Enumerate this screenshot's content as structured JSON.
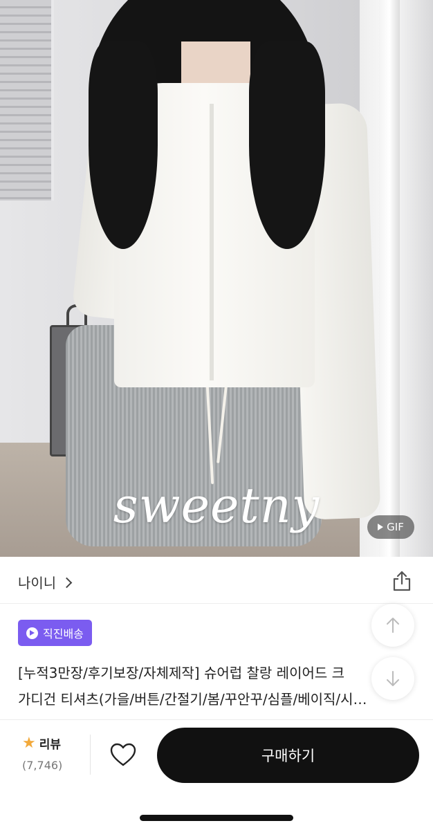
{
  "photo": {
    "watermark": "sweetny",
    "gif_badge": "GIF"
  },
  "store": {
    "name": "나이니"
  },
  "product": {
    "delivery_badge": "직진배송",
    "title_line1": "[누적3만장/후기보장/자체제작] 슈어럽 찰랑 레이어드 크",
    "title_line2": "가디건 티셔츠(가을/버튼/간절기/봄/꾸안꾸/심플/베이직/시…"
  },
  "bottom_bar": {
    "review_label": "리뷰",
    "review_count": "(7,746)",
    "buy_label": "구매하기"
  },
  "colors": {
    "badge": "#7b5cf0",
    "buy_button": "#111111",
    "star": "#f2a93b"
  },
  "icons": [
    "share-icon",
    "arrow-up-icon",
    "arrow-down-icon",
    "star-icon",
    "heart-icon",
    "play-icon",
    "chevron-right-icon"
  ]
}
